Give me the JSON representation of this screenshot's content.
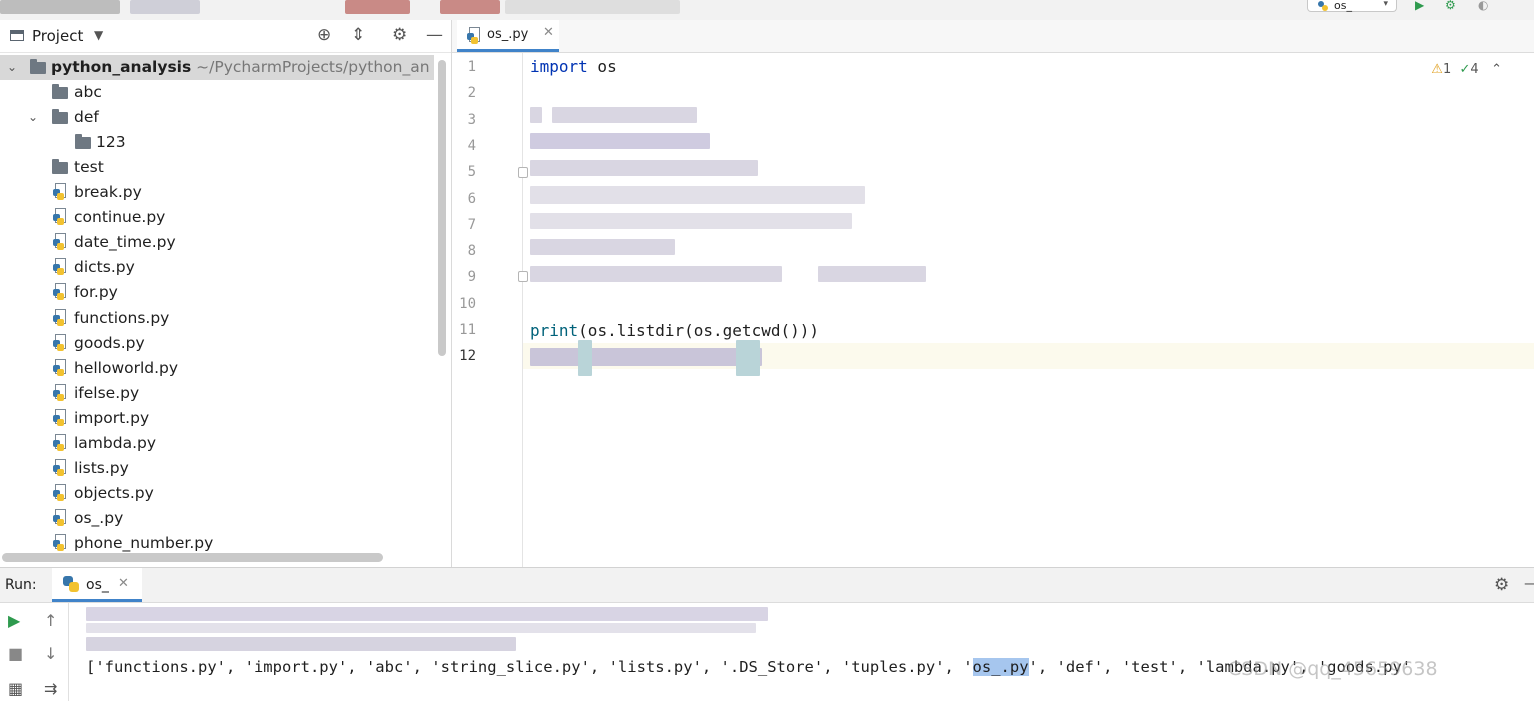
{
  "project_panel": {
    "title": "Project",
    "root": {
      "name": "python_analysis",
      "path": "~/PycharmProjects/python_an"
    },
    "folders": [
      "abc",
      "def",
      "123",
      "test"
    ],
    "files": [
      "break.py",
      "continue.py",
      "date_time.py",
      "dicts.py",
      "for.py",
      "functions.py",
      "goods.py",
      "helloworld.py",
      "ifelse.py",
      "import.py",
      "lambda.py",
      "lists.py",
      "objects.py",
      "os_.py",
      "phone_number.py"
    ]
  },
  "editor": {
    "tab_label": "os_.py",
    "line_numbers": [
      "1",
      "2",
      "3",
      "4",
      "5",
      "6",
      "7",
      "8",
      "9",
      "10",
      "11",
      "12"
    ],
    "code": {
      "line1_kw": "import",
      "line1_rest": " os",
      "line11_fn": "print",
      "line11_rest": "(os.listdir(os.getcwd()))"
    },
    "inspections": {
      "warnings": "1",
      "typos": "4"
    }
  },
  "run_panel": {
    "label": "Run:",
    "tab_label": "os_",
    "output_before": "['functions.py', 'import.py', 'abc', 'string_slice.py', 'lists.py', '.DS_Store', 'tuples.py', '",
    "output_highlight": "os_.py",
    "output_after": "', 'def', 'test', 'lambda.py', 'goods.py'"
  },
  "toolbar": {
    "run_config": "os_"
  },
  "watermark": "CSDN @qq_45659638",
  "colors": {
    "accent": "#4083c9",
    "keyword": "#0033b3",
    "selection": "#a6c6ee"
  }
}
